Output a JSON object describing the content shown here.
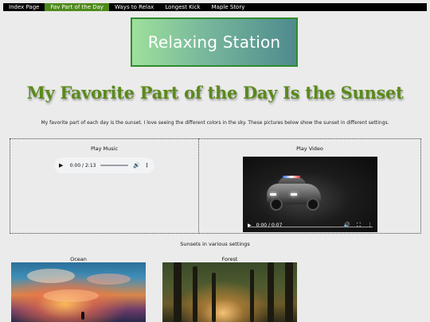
{
  "nav": {
    "items": [
      {
        "label": "Index Page",
        "active": false
      },
      {
        "label": "Fav Part of the Day",
        "active": true
      },
      {
        "label": "Ways to Relax",
        "active": false
      },
      {
        "label": "Longest Kick",
        "active": false
      },
      {
        "label": "Maple Story",
        "active": false
      }
    ]
  },
  "logo": {
    "text": "Relaxing Station"
  },
  "heading": "My Favorite Part of the Day Is the Sunset",
  "intro": "My favorite part of each day is the sunset. I love seeing the different colors in the sky. These pictures below show the sunset in different settings.",
  "media": {
    "music": {
      "title": "Play Music",
      "time": "0:00 / 2:13"
    },
    "video": {
      "title": "Play Video",
      "time": "0:00 / 0:07"
    }
  },
  "gallery": {
    "title": "Sunsets in various settings",
    "items": [
      {
        "caption": "Ocean"
      },
      {
        "caption": "Forest"
      }
    ]
  },
  "colors": {
    "nav_active": "#4e8a1a",
    "heading": "#5a8a1a",
    "logo_border": "#2f8a2f"
  }
}
